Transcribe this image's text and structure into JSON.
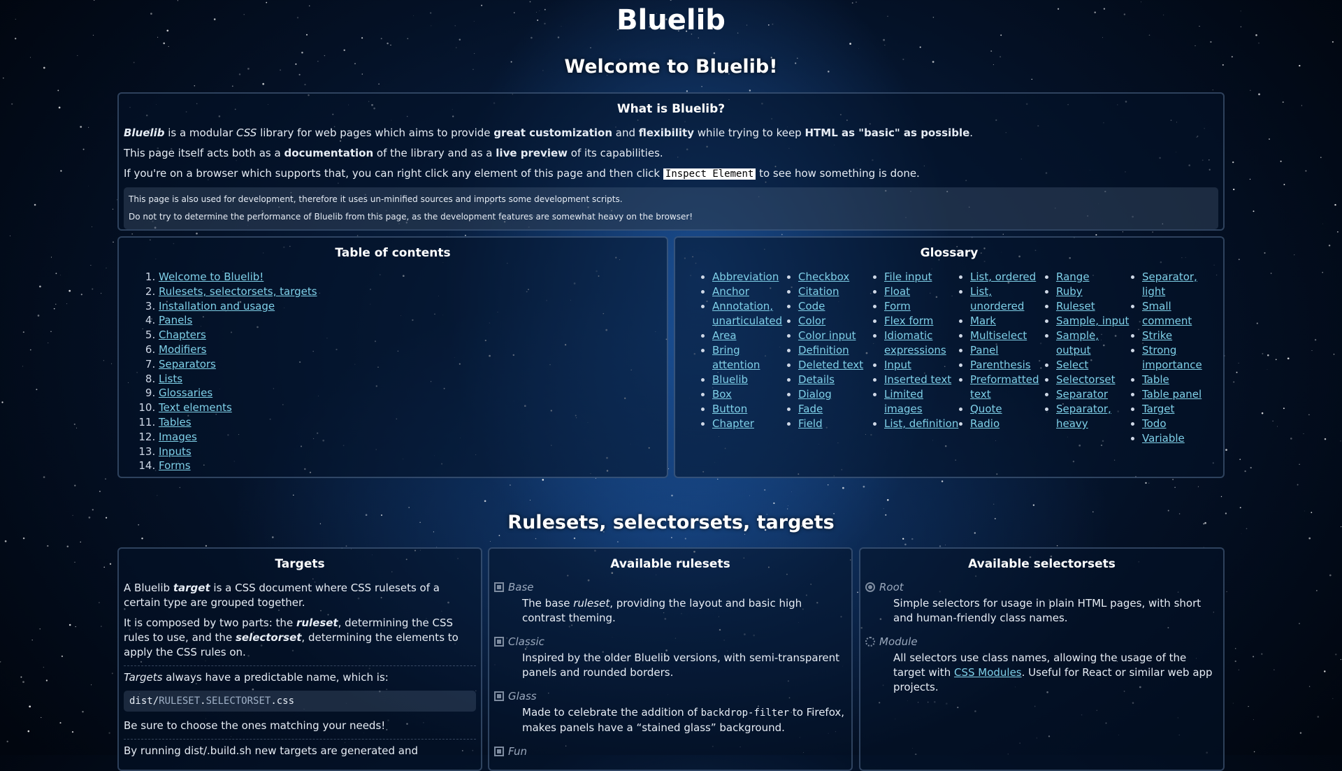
{
  "site_title": "Bluelib",
  "welcome": {
    "heading": "Welcome to Bluelib!",
    "what_is": {
      "title": "What is Bluelib?",
      "p1": {
        "name": "Bluelib",
        "t1": " is a modular ",
        "css": "CSS",
        "t2": " library for web pages which aims to provide ",
        "b1": "great customization",
        "t3": " and ",
        "b2": "flexibility",
        "t4": " while trying to keep ",
        "b3": "HTML as \"basic\" as possible",
        "t5": "."
      },
      "p2": {
        "t1": "This page itself acts both as a ",
        "b1": "documentation",
        "t2": " of the library and as a ",
        "b2": "live preview",
        "t3": " of its capabilities."
      },
      "p3": {
        "t1": "If you're on a browser which supports that, you can right click any element of this page and then click ",
        "kbd": "Inspect Element",
        "t2": " to see how something is done."
      },
      "note_lines": [
        "This page is also used for development, therefore it uses un-minified sources and imports some development scripts.",
        "Do not try to determine the performance of Bluelib from this page, as the development features are somewhat heavy on the browser!"
      ]
    },
    "toc": {
      "title": "Table of contents",
      "items": [
        "Welcome to Bluelib!",
        "Rulesets, selectorsets, targets",
        "Installation and usage",
        "Panels",
        "Chapters",
        "Modifiers",
        "Separators",
        "Lists",
        "Glossaries",
        "Text elements",
        "Tables",
        "Images",
        "Inputs",
        "Forms"
      ]
    },
    "glossary": {
      "title": "Glossary",
      "columns": [
        [
          "Abbreviation",
          "Anchor",
          "Annotation, unarticulated",
          "Area",
          "Bring attention",
          "Bluelib",
          "Box",
          "Button",
          "Chapter"
        ],
        [
          "Checkbox",
          "Citation",
          "Code",
          "Color",
          "Color input",
          "Definition",
          "Deleted text",
          "Details",
          "Dialog",
          "Fade",
          "Field"
        ],
        [
          "File input",
          "Float",
          "Form",
          "Flex form",
          "Idiomatic expressions",
          "Input",
          "Inserted text",
          "Limited images",
          "List, definition"
        ],
        [
          "List, ordered",
          "List, unordered",
          "Mark",
          "Multiselect",
          "Panel",
          "Parenthesis",
          "Preformatted text",
          "Quote",
          "Radio"
        ],
        [
          "Range",
          "Ruby",
          "Ruleset",
          "Sample, input",
          "Sample, output",
          "Select",
          "Selectorset",
          "Separator",
          "Separator, heavy"
        ],
        [
          "Separator, light",
          "Small comment",
          "Strike",
          "Strong importance",
          "Table",
          "Table panel",
          "Target",
          "Todo",
          "Variable"
        ]
      ]
    }
  },
  "rulesets": {
    "heading": "Rulesets, selectorsets, targets",
    "targets": {
      "title": "Targets",
      "p1": {
        "t1": "A Bluelib ",
        "em": "target",
        "t2": " is a CSS document where CSS rulesets of a certain type are grouped together."
      },
      "p2": {
        "t1": "It is composed by two parts: the ",
        "em1": "ruleset",
        "t2": ", determining the CSS rules to use, and the ",
        "em2": "selectorset",
        "t3": ", determining the elements to apply the CSS rules on."
      },
      "p3": {
        "em": "Targets",
        "t1": " always have a predictable name, which is:"
      },
      "code": {
        "pre": "dist/",
        "v1": "RULESET",
        "dot": ".",
        "v2": "SELECTORSET",
        "post": ".css"
      },
      "p4": "Be sure to choose the ones matching your needs!",
      "p5": "By running dist/.build.sh new targets are generated and"
    },
    "available_rulesets": {
      "title": "Available rulesets",
      "items": [
        {
          "label": "Base",
          "desc_pre": "The base ",
          "desc_em": "ruleset",
          "desc_post": ", providing the layout and basic high contrast theming."
        },
        {
          "label": "Classic",
          "desc_pre": "Inspired by the older Bluelib versions, with semi-transparent panels and rounded borders.",
          "desc_em": "",
          "desc_post": ""
        },
        {
          "label": "Glass",
          "desc_pre": "Made to celebrate the addition of ",
          "desc_code": "backdrop-filter",
          "desc_post": " to Firefox, makes panels have a “stained glass” background."
        },
        {
          "label": "Fun"
        }
      ]
    },
    "available_selectorsets": {
      "title": "Available selectorsets",
      "items": [
        {
          "label": "Root",
          "desc": "Simple selectors for usage in plain HTML pages, with short and human-friendly class names."
        },
        {
          "label": "Module",
          "desc_pre": "All selectors use class names, allowing the usage of the target with ",
          "desc_link": "CSS Modules",
          "desc_post": ". Useful for React or similar web app projects."
        }
      ]
    }
  },
  "colors": {
    "link": "#7fd0e8",
    "background": "#041126",
    "panel_border": "#4a607e"
  }
}
